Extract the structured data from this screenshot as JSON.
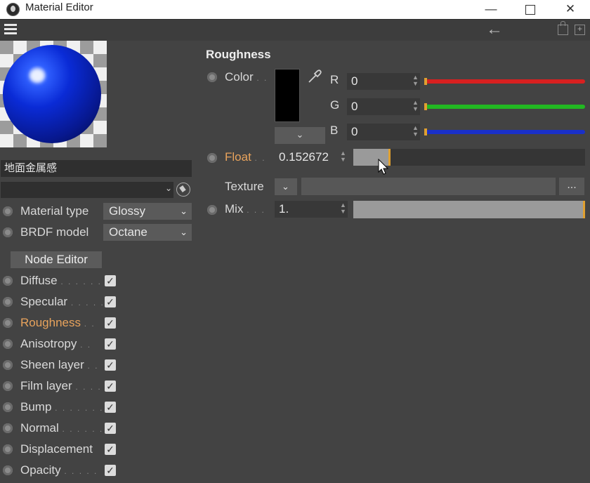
{
  "window": {
    "title": "Material Editor",
    "controls": {
      "minimize": "—",
      "close": "✕"
    }
  },
  "menubar": {
    "back_icon": "←",
    "newwin_icon": "+"
  },
  "preview": {
    "material_name": "地面金属感"
  },
  "left_panel": {
    "material_type_label": "Material type",
    "material_type_value": "Glossy",
    "brdf_label": "BRDF model",
    "brdf_value": "Octane",
    "node_editor_label": "Node Editor",
    "channels": [
      {
        "label": "Diffuse",
        "dots": ". . . . . .",
        "active": false,
        "checked": true
      },
      {
        "label": "Specular",
        "dots": ". . . . .",
        "active": false,
        "checked": true
      },
      {
        "label": "Roughness",
        "dots": ". .",
        "active": true,
        "checked": true
      },
      {
        "label": "Anisotropy",
        "dots": ". .",
        "active": false,
        "checked": true
      },
      {
        "label": "Sheen layer",
        "dots": ". .",
        "active": false,
        "checked": true
      },
      {
        "label": "Film layer",
        "dots": ". . . .",
        "active": false,
        "checked": true
      },
      {
        "label": "Bump",
        "dots": ". . . . . . .",
        "active": false,
        "checked": true
      },
      {
        "label": "Normal",
        "dots": ". . . . . .",
        "active": false,
        "checked": true
      },
      {
        "label": "Displacement",
        "dots": "",
        "active": false,
        "checked": true
      },
      {
        "label": "Opacity",
        "dots": ". . . . .",
        "active": false,
        "checked": true
      }
    ],
    "check_glyph": "✓",
    "chevron": "⌄"
  },
  "roughness": {
    "title": "Roughness",
    "color_label": "Color",
    "color_dots": ". .",
    "swatch_color": "#000000",
    "r_label": "R",
    "r_value": "0",
    "g_label": "G",
    "g_value": "0",
    "b_label": "B",
    "b_value": "0",
    "float_label": "Float",
    "float_dots": ". .",
    "float_value": "0.152672",
    "float_fraction": 0.152672,
    "texture_label": "Texture",
    "texture_btn": "...",
    "mix_label": "Mix",
    "mix_dots": ". . .",
    "mix_value": "1.",
    "mix_fraction": 1.0
  },
  "colors": {
    "red": "#e02020",
    "green": "#20c020",
    "blue": "#2030d0",
    "accent": "#e8a35c"
  }
}
